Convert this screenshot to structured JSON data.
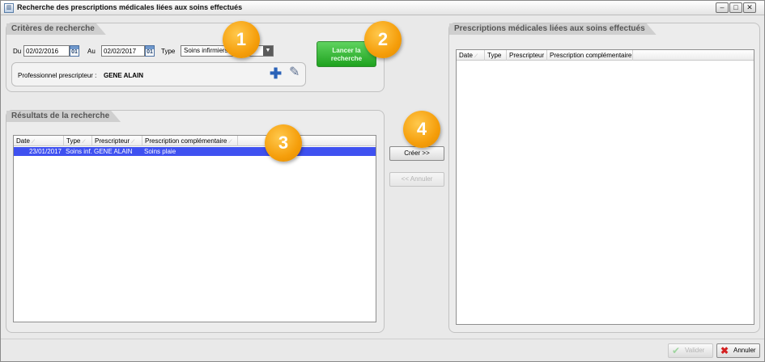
{
  "window": {
    "title": "Recherche des prescriptions médicales liées aux soins effectués",
    "app_icon": "app-icon",
    "controls": [
      "minimize-icon",
      "maximize-icon",
      "close-icon"
    ]
  },
  "criteria": {
    "tab": "Critères de recherche",
    "du_label": "Du",
    "du_value": "02/02/2016",
    "au_label": "Au",
    "au_value": "02/02/2017",
    "calendar_icon_text": "01",
    "type_label": "Type",
    "type_value": "Soins infirmiers",
    "prescriber_label": "Professionnel prescripteur :",
    "prescriber_value": "GENE ALAIN",
    "add_icon": "plus-icon",
    "clear_icon": "eraser-icon",
    "search_button": "Lancer la recherche"
  },
  "results": {
    "tab": "Résultats de la recherche",
    "columns": [
      "Date",
      "Type",
      "Prescripteur",
      "Prescription complémentaire"
    ],
    "rows": [
      {
        "date": "23/01/2017",
        "type": "Soins inf...",
        "prescriber": "GENE ALAIN",
        "complement": "Soins plaie"
      }
    ],
    "selected_row_color": "#3f51f0"
  },
  "actions": {
    "create": "Créer >>",
    "cancel": "<< Annuler"
  },
  "linked": {
    "tab": "Prescriptions médicales liées aux soins effectués",
    "columns": [
      "Date",
      "Type",
      "Prescripteur",
      "Prescription complémentaire"
    ]
  },
  "footer": {
    "validate": "Valider",
    "cancel": "Annuler"
  },
  "badges": [
    "1",
    "2",
    "3",
    "4"
  ],
  "colors": {
    "accent_green": "#1fa21f",
    "badge_orange": "#f59e0b",
    "selection_blue": "#3f51f0"
  }
}
